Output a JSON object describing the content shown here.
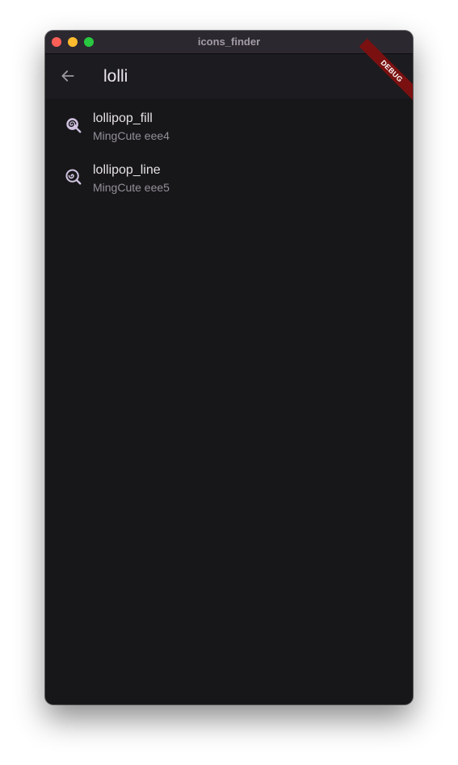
{
  "window": {
    "title": "icons_finder"
  },
  "appbar": {
    "search_value": "lolli",
    "back_icon": "arrow-left-icon",
    "debug_label": "DEBUG"
  },
  "results": [
    {
      "name": "lollipop_fill",
      "subtitle": "MingCute eee4",
      "icon": "lollipop-fill-icon"
    },
    {
      "name": "lollipop_line",
      "subtitle": "MingCute eee5",
      "icon": "lollipop-line-icon"
    }
  ],
  "colors": {
    "background": "#171719",
    "appbar": "#1c1b1f",
    "titlebar": "#2c2830",
    "primary_text": "#e6e1e5",
    "secondary_text": "#938f99",
    "icon": "#d0c2e0",
    "debug_banner": "#7b1010"
  }
}
